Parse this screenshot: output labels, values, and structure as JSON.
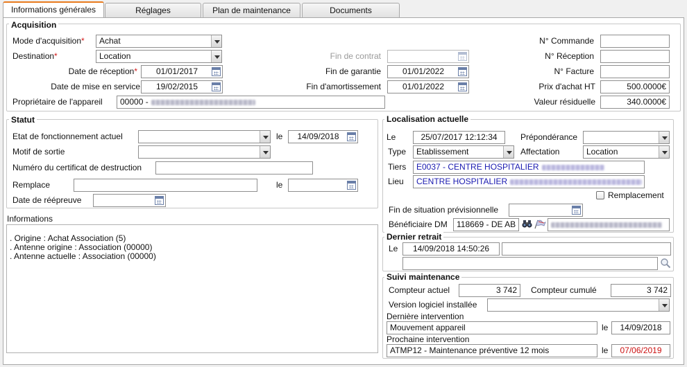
{
  "tabs": [
    "Informations générales",
    "Réglages",
    "Plan de maintenance",
    "Documents"
  ],
  "acquisition": {
    "title": "Acquisition",
    "mode_label": "Mode d'acquisition",
    "mode_value": "Achat",
    "destination_label": "Destination",
    "destination_value": "Location",
    "required_mark": "*",
    "date_reception_label": "Date de réception",
    "date_reception_value": "01/01/2017",
    "date_mise_service_label": "Date de mise en service",
    "date_mise_service_value": "19/02/2015",
    "proprietaire_label": "Propriétaire de l'appareil",
    "proprietaire_value": "00000 -",
    "fin_contrat_label": "Fin de contrat",
    "fin_contrat_value": "",
    "fin_garantie_label": "Fin de garantie",
    "fin_garantie_value": "01/01/2022",
    "fin_amortissement_label": "Fin d'amortissement",
    "fin_amortissement_value": "01/01/2022",
    "commande_label": "N° Commande",
    "commande_value": "",
    "reception_label": "N° Réception",
    "reception_value": "",
    "facture_label": "N° Facture",
    "facture_value": "",
    "prix_label": "Prix d'achat HT",
    "prix_value": "500.0000€",
    "valeur_label": "Valeur résiduelle",
    "valeur_value": "340.0000€"
  },
  "statut": {
    "title": "Statut",
    "etat_label": "Etat de fonctionnement actuel",
    "etat_value": "",
    "le_label": "le",
    "etat_date": "14/09/2018",
    "motif_label": "Motif de sortie",
    "motif_value": "",
    "certificat_label": "Numéro du certificat de destruction",
    "certificat_value": "",
    "remplace_label": "Remplace",
    "remplace_value": "",
    "remplace_date": "",
    "reepreuve_label": "Date de réépreuve",
    "reepreuve_value": ""
  },
  "informations": {
    "title": "Informations",
    "lines": [
      ". Origine : Achat Association (5)",
      ". Antenne origine : Association (00000)",
      ". Antenne actuelle : Association (00000)"
    ]
  },
  "localisation": {
    "title": "Localisation actuelle",
    "le_label": "Le",
    "le_value": "25/07/2017 12:12:34",
    "preponderance_label": "Prépondérance",
    "preponderance_value": "",
    "type_label": "Type",
    "type_value": "Etablissement",
    "affectation_label": "Affectation",
    "affectation_value": "Location",
    "tiers_label": "Tiers",
    "tiers_value": "E0037 - CENTRE HOSPITALIER",
    "lieu_label": "Lieu",
    "lieu_value": "CENTRE HOSPITALIER",
    "remplacement_label": "Remplacement",
    "fin_situation_label": "Fin de situation prévisionnelle",
    "fin_situation_value": "",
    "beneficiaire_label": "Bénéficiaire DM",
    "beneficiaire_value": "118669 - DE AB"
  },
  "dernier_retrait": {
    "title": "Dernier retrait",
    "le_label": "Le",
    "le_value": "14/09/2018 14:50:26",
    "field1": "",
    "field2": ""
  },
  "suivi": {
    "title": "Suivi maintenance",
    "compteur_actuel_label": "Compteur actuel",
    "compteur_actuel_value": "3 742",
    "compteur_cumule_label": "Compteur cumulé",
    "compteur_cumule_value": "3 742",
    "version_label": "Version logiciel installée",
    "version_value": "",
    "derniere_label": "Dernière intervention",
    "derniere_value": "Mouvement appareil",
    "derniere_le": "le",
    "derniere_date": "14/09/2018",
    "prochaine_label": "Prochaine intervention",
    "prochaine_value": "ATMP12 - Maintenance préventive 12 mois",
    "prochaine_le": "le",
    "prochaine_date": "07/06/2019"
  },
  "colors": {
    "accent": "#e87a1d",
    "required": "#d41a1a",
    "overdue": "#cc1111",
    "link": "#1a1ab0"
  },
  "icons": [
    "calendar-icon",
    "binoculars-icon",
    "flag-icon",
    "magnifier-icon",
    "dropdown-arrow-icon"
  ]
}
